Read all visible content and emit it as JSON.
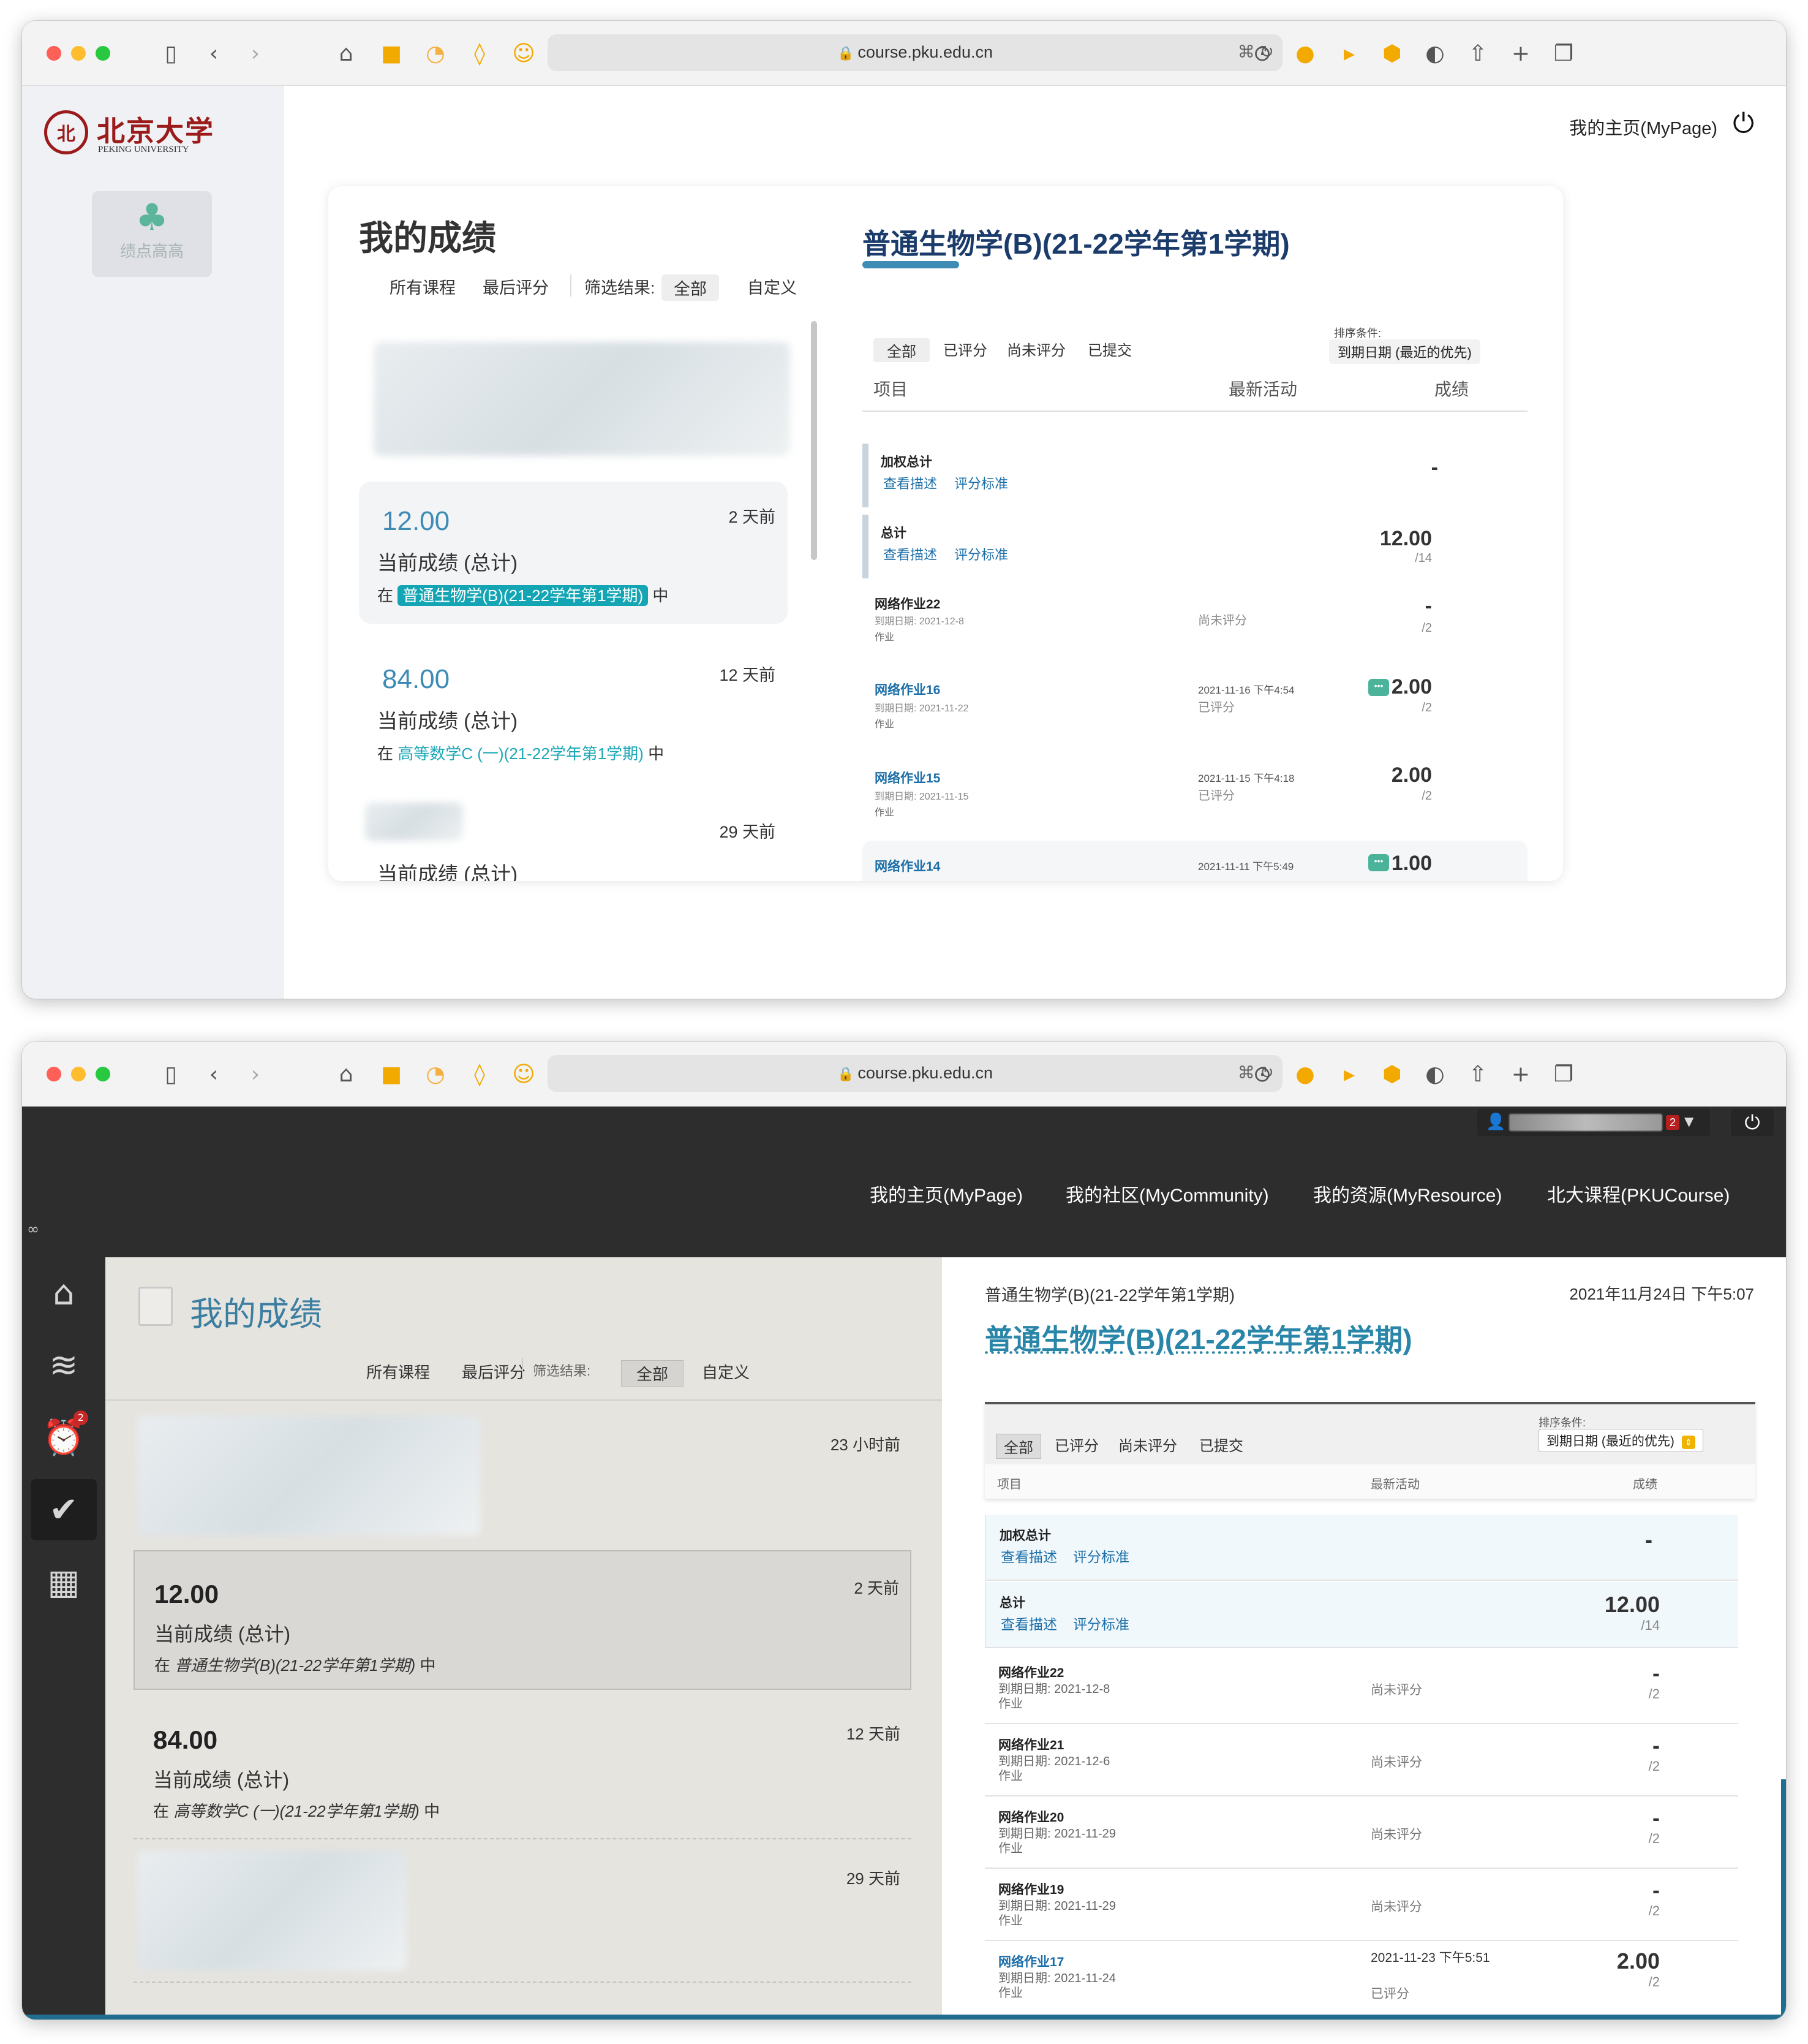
{
  "browser": {
    "url": "course.pku.edu.cn",
    "icons": [
      "sidebar-icon",
      "back-icon",
      "forward-icon",
      "home-icon",
      "extension-icon",
      "rss-icon",
      "shield-icon",
      "avatar-icon",
      "translate-icon",
      "reload-icon",
      "download-icon",
      "flame-icon",
      "arrow-icon",
      "hexagon-icon",
      "half-shield-icon",
      "share-icon",
      "new-tab-icon",
      "tabs-icon"
    ]
  },
  "win1": {
    "logo": {
      "cn": "北京大学",
      "en": "PEKING UNIVERSITY"
    },
    "gpa_label": "绩点高高",
    "mypage": "我的主页(MyPage)",
    "title": "我的成绩",
    "filters": {
      "all_courses": "所有课程",
      "last_graded": "最后评分",
      "filter_label": "筛选结果:",
      "all": "全部",
      "custom": "自定义"
    },
    "items": [
      {
        "score": "12.00",
        "time": "2 天前",
        "desc": "当前成绩 (总计)",
        "pre": "在",
        "course": "普通生物学(B)(21-22学年第1学期)",
        "post": "中"
      },
      {
        "score": "84.00",
        "time": "12 天前",
        "desc": "当前成绩 (总计)",
        "pre": "在",
        "course": "高等数学C (一)(21-22学年第1学期)",
        "post": "中"
      },
      {
        "time": "29 天前",
        "desc": "当前成绩 (总计)"
      }
    ],
    "course_title": "普通生物学(B)(21-22学年第1学期)",
    "tabs": {
      "all": "全部",
      "graded": "已评分",
      "ungraded": "尚未评分",
      "submitted": "已提交"
    },
    "sort_label": "排序条件:",
    "sort_value": "到期日期 (最近的优先)",
    "headers": {
      "item": "项目",
      "activity": "最新活动",
      "grade": "成绩"
    },
    "rows": [
      {
        "name": "加权总计",
        "link1": "查看描述",
        "link2": "评分标准",
        "score": "-"
      },
      {
        "name": "总计",
        "link1": "查看描述",
        "link2": "评分标准",
        "score": "12.00",
        "out": "/14"
      },
      {
        "name": "网络作业22",
        "due": "到期日期: 2021-12-8",
        "type": "作业",
        "activity": "尚未评分",
        "score": "-",
        "out": "/2"
      },
      {
        "name": "网络作业16",
        "due": "到期日期: 2021-11-22",
        "type": "作业",
        "activity": "2021-11-16 下午4:54",
        "status": "已评分",
        "score": "2.00",
        "out": "/2"
      },
      {
        "name": "网络作业15",
        "due": "到期日期: 2021-11-15",
        "type": "作业",
        "activity": "2021-11-15 下午4:18",
        "status": "已评分",
        "score": "2.00",
        "out": "/2"
      },
      {
        "name": "网络作业14",
        "activity": "2021-11-11 下午5:49",
        "score": "1.00"
      }
    ]
  },
  "win2": {
    "nav": [
      "我的主页(MyPage)",
      "我的社区(MyCommunity)",
      "我的资源(MyResource)",
      "北大课程(PKUCourse)"
    ],
    "user_badge": "2",
    "rail_badge": "2",
    "rail_icons": [
      "blackboard-home-icon",
      "stream-icon",
      "alarm-clock-icon",
      "grades-icon",
      "calendar-icon"
    ],
    "title": "我的成绩",
    "filters": {
      "all_courses": "所有课程",
      "last_graded": "最后评分",
      "filter_label": "筛选结果:",
      "all": "全部",
      "custom": "自定义"
    },
    "items": [
      {
        "time": "23 小时前"
      },
      {
        "score": "12.00",
        "time": "2 天前",
        "desc": "当前成绩 (总计)",
        "pre": "在",
        "course": "普通生物学(B)(21-22学年第1学期)",
        "post": "中"
      },
      {
        "score": "84.00",
        "time": "12 天前",
        "desc": "当前成绩 (总计)",
        "pre": "在",
        "course": "高等数学C (一)(21-22学年第1学期)",
        "post": "中"
      },
      {
        "time": "29 天前"
      }
    ],
    "breadcrumb": "普通生物学(B)(21-22学年第1学期)",
    "datetime": "2021年11月24日 下午5:07",
    "course_title": "普通生物学(B)(21-22学年第1学期)",
    "tabs": {
      "all": "全部",
      "graded": "已评分",
      "ungraded": "尚未评分",
      "submitted": "已提交"
    },
    "sort_label": "排序条件:",
    "sort_value": "到期日期 (最近的优先)",
    "headers": {
      "item": "项目",
      "activity": "最新活动",
      "grade": "成绩"
    },
    "rows": [
      {
        "name": "加权总计",
        "link1": "查看描述",
        "link2": "评分标准",
        "score": "-"
      },
      {
        "name": "总计",
        "link1": "查看描述",
        "link2": "评分标准",
        "score": "12.00",
        "out": "/14"
      },
      {
        "name": "网络作业22",
        "due": "到期日期: 2021-12-8",
        "type": "作业",
        "activity": "尚未评分",
        "score": "-",
        "out": "/2"
      },
      {
        "name": "网络作业21",
        "due": "到期日期: 2021-12-6",
        "type": "作业",
        "activity": "尚未评分",
        "score": "-",
        "out": "/2"
      },
      {
        "name": "网络作业20",
        "due": "到期日期: 2021-11-29",
        "type": "作业",
        "activity": "尚未评分",
        "score": "-",
        "out": "/2"
      },
      {
        "name": "网络作业19",
        "due": "到期日期: 2021-11-29",
        "type": "作业",
        "activity": "尚未评分",
        "score": "-",
        "out": "/2"
      },
      {
        "name": "网络作业17",
        "due": "到期日期: 2021-11-24",
        "type": "作业",
        "activity": "2021-11-23 下午5:51",
        "status": "已评分",
        "score": "2.00",
        "out": "/2"
      }
    ]
  },
  "colors": {
    "accent_blue": "#3e8bb5",
    "teal": "#14a5b4",
    "bb_dark": "#2d2d2d",
    "bb_link": "#2a86a8"
  }
}
